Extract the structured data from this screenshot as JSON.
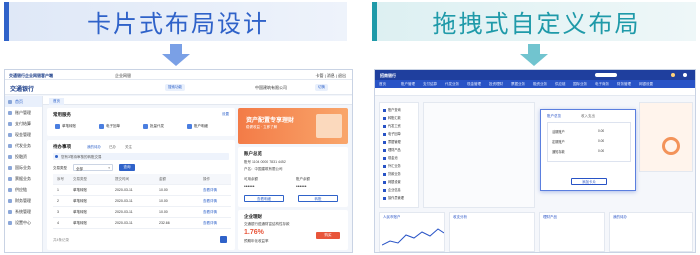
{
  "left": {
    "heading": "卡片式布局设计",
    "topbar": {
      "app_name": "交通银行企业网银客户端",
      "product": "企业网银",
      "user_info": "卡管 | 消息 | 退出"
    },
    "header": {
      "brand": "交通银行",
      "org_name": "中国建筑有限公司",
      "btn_search": "搜索功能",
      "btn_switch": "切换"
    },
    "sidebar": {
      "items": [
        {
          "label": "首页"
        },
        {
          "label": "账户管理"
        },
        {
          "label": "支付结算"
        },
        {
          "label": "现金管理"
        },
        {
          "label": "代发业务"
        },
        {
          "label": "投融资"
        },
        {
          "label": "国际业务"
        },
        {
          "label": "票据业务"
        },
        {
          "label": "供应链"
        },
        {
          "label": "财务管理"
        },
        {
          "label": "系统管理"
        },
        {
          "label": "设置中心"
        }
      ]
    },
    "tabbar": {
      "tab": "首页"
    },
    "quick": {
      "title": "常用服务",
      "more": "设置",
      "items": [
        {
          "label": "单笔转账"
        },
        {
          "label": "电子回单"
        },
        {
          "label": "批量代发"
        },
        {
          "label": "账户明细"
        }
      ]
    },
    "banner": {
      "line1": "资产配置专享理财",
      "line2": "稳健收益 · 立即了解"
    },
    "todo": {
      "title": "待办事项",
      "tabs": [
        "我的待办",
        "已办",
        "关注"
      ],
      "notice": "您有3笔待审核的转账交易",
      "filter_label": "交易类型",
      "filter_value": "全部",
      "btn_query": "查询",
      "columns": [
        "序号",
        "交易类型",
        "提交时间",
        "金额",
        "操作"
      ],
      "rows": [
        {
          "no": "1",
          "type": "单笔转账",
          "date": "2020-03-11",
          "amount": "10.00",
          "action": "查看详情"
        },
        {
          "no": "2",
          "type": "单笔转账",
          "date": "2020-03-11",
          "amount": "10.00",
          "action": "查看详情"
        },
        {
          "no": "3",
          "type": "单笔转账",
          "date": "2020-03-11",
          "amount": "10.00",
          "action": "查看详情"
        },
        {
          "no": "4",
          "type": "单笔转账",
          "date": "2020-03-11",
          "amount": "232.66",
          "action": "查看详情"
        }
      ],
      "footer": "共4条记录"
    },
    "account": {
      "title": "账户总览",
      "account_no": "账号 1104 0000 7831 4452",
      "account_name": "户名：中国建筑有限公司",
      "balance_label": "可用余额",
      "balance_label2": "账户余额",
      "mask1": "••••••",
      "mask2": "••••••",
      "btn_detail": "查看明细",
      "btn_transfer": "转账"
    },
    "wealth": {
      "title": "企业理财",
      "product": "交通银行蕴通财富结构性存款",
      "rate": "1.76%",
      "rate_label": "预期年化收益率",
      "btn": "购买"
    }
  },
  "right": {
    "heading": "拖拽式自定义布局",
    "topbar": {
      "brand": "招商银行"
    },
    "nav": [
      "首页",
      "账户管理",
      "支付结算",
      "代发业务",
      "现金管理",
      "投资理财",
      "票据业务",
      "融资业务",
      "供应链",
      "国际业务",
      "电子商务",
      "财务管理",
      "网银设置"
    ],
    "sidebar_items": [
      "账户查询",
      "转账汇款",
      "代发工资",
      "电子回单",
      "票据管理",
      "理财产品",
      "现金池",
      "外汇业务",
      "贷款业务",
      "网银设置",
      "企业信息",
      "操作员管理"
    ],
    "drag_panel": {
      "title_left": "账户总览",
      "title_right": "收入支出",
      "rows": [
        {
          "label": "活期账户",
          "value": "0.00"
        },
        {
          "label": "定期账户",
          "value": "0.00"
        },
        {
          "label": "通知存款",
          "value": "0.00"
        }
      ],
      "btn": "添加卡片"
    },
    "labels": {
      "widget1": "人民币账户",
      "widget2": "收支分析",
      "widget3": "理财产品",
      "widget4": "我的待办"
    }
  }
}
